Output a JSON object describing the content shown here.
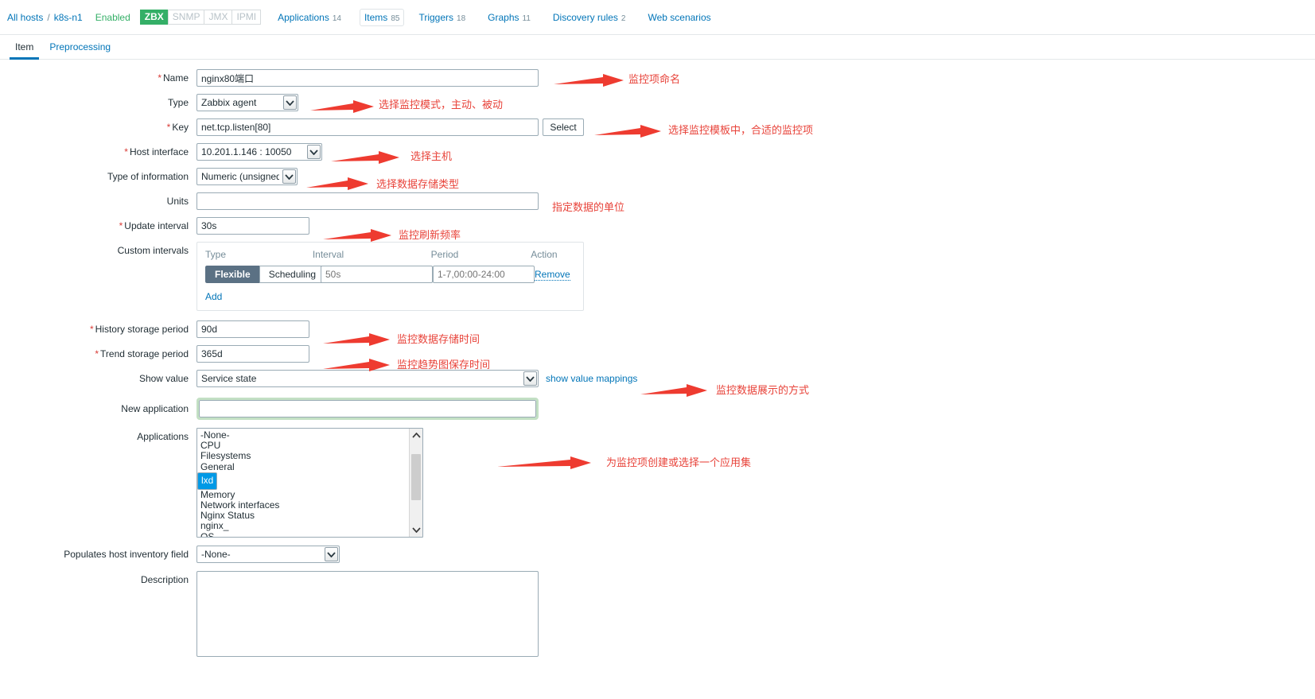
{
  "hostnav": {
    "all_hosts": "All hosts",
    "separator": "/",
    "host": "k8s-n1",
    "status": "Enabled",
    "interfaces": [
      {
        "label": "ZBX",
        "active": true
      },
      {
        "label": "SNMP",
        "active": false
      },
      {
        "label": "JMX",
        "active": false
      },
      {
        "label": "IPMI",
        "active": false
      }
    ],
    "links": [
      {
        "label": "Applications",
        "count": "14",
        "selected": false
      },
      {
        "label": "Items",
        "count": "85",
        "selected": true
      },
      {
        "label": "Triggers",
        "count": "18",
        "selected": false
      },
      {
        "label": "Graphs",
        "count": "11",
        "selected": false
      },
      {
        "label": "Discovery rules",
        "count": "2",
        "selected": false
      },
      {
        "label": "Web scenarios",
        "count": "",
        "selected": false
      }
    ]
  },
  "tabs": [
    {
      "label": "Item",
      "active": true
    },
    {
      "label": "Preprocessing",
      "active": false
    }
  ],
  "form": {
    "name": {
      "label": "Name",
      "required": true,
      "value": "nginx80端口"
    },
    "type": {
      "label": "Type",
      "required": false,
      "value": "Zabbix agent"
    },
    "key": {
      "label": "Key",
      "required": true,
      "value": "net.tcp.listen[80]",
      "select_button": "Select"
    },
    "host_interface": {
      "label": "Host interface",
      "required": true,
      "value": "10.201.1.146 : 10050"
    },
    "type_of_information": {
      "label": "Type of information",
      "required": false,
      "value": "Numeric (unsigned)"
    },
    "units": {
      "label": "Units",
      "required": false,
      "value": ""
    },
    "update_interval": {
      "label": "Update interval",
      "required": true,
      "value": "30s"
    },
    "custom_intervals": {
      "label": "Custom intervals",
      "headers": {
        "type": "Type",
        "interval": "Interval",
        "period": "Period",
        "action": "Action"
      },
      "row": {
        "flexible": "Flexible",
        "scheduling": "Scheduling",
        "selected_type": "Flexible",
        "interval_placeholder": "50s",
        "period_placeholder": "1-7,00:00-24:00",
        "remove": "Remove"
      },
      "add": "Add"
    },
    "history_storage_period": {
      "label": "History storage period",
      "required": true,
      "value": "90d"
    },
    "trend_storage_period": {
      "label": "Trend storage period",
      "required": true,
      "value": "365d"
    },
    "show_value": {
      "label": "Show value",
      "value": "Service state",
      "mappings_link": "show value mappings"
    },
    "new_application": {
      "label": "New application",
      "value": ""
    },
    "applications": {
      "label": "Applications",
      "options": [
        "-None-",
        "CPU",
        "Filesystems",
        "General",
        "lxd",
        "Memory",
        "Network interfaces",
        "Nginx Status",
        "nginx_",
        "OS"
      ],
      "selected": "lxd"
    },
    "populates_host_inventory_field": {
      "label": "Populates host inventory field",
      "value": "-None-"
    },
    "description": {
      "label": "Description",
      "value": ""
    }
  },
  "annotations": [
    {
      "id": "a-name",
      "text": "监控项命名"
    },
    {
      "id": "a-type",
      "text": "选择监控模式，主动、被动"
    },
    {
      "id": "a-key",
      "text": "选择监控模板中，合适的监控项"
    },
    {
      "id": "a-iface",
      "text": "选择主机"
    },
    {
      "id": "a-info",
      "text": "选择数据存储类型"
    },
    {
      "id": "a-units",
      "text": "指定数据的单位"
    },
    {
      "id": "a-interval",
      "text": "监控刷新频率"
    },
    {
      "id": "a-history",
      "text": "监控数据存储时间"
    },
    {
      "id": "a-trend",
      "text": "监控趋势图保存时间"
    },
    {
      "id": "a-showvalue",
      "text": "监控数据展示的方式"
    },
    {
      "id": "a-apps",
      "text": "为监控项创建或选择一个应用集"
    }
  ],
  "colors": {
    "accent": "#0275b8",
    "enabled": "#34af67",
    "required": "#d93c37",
    "annotation": "#e8433a",
    "selection": "#0099e6",
    "toggle_on": "#5b7184"
  }
}
